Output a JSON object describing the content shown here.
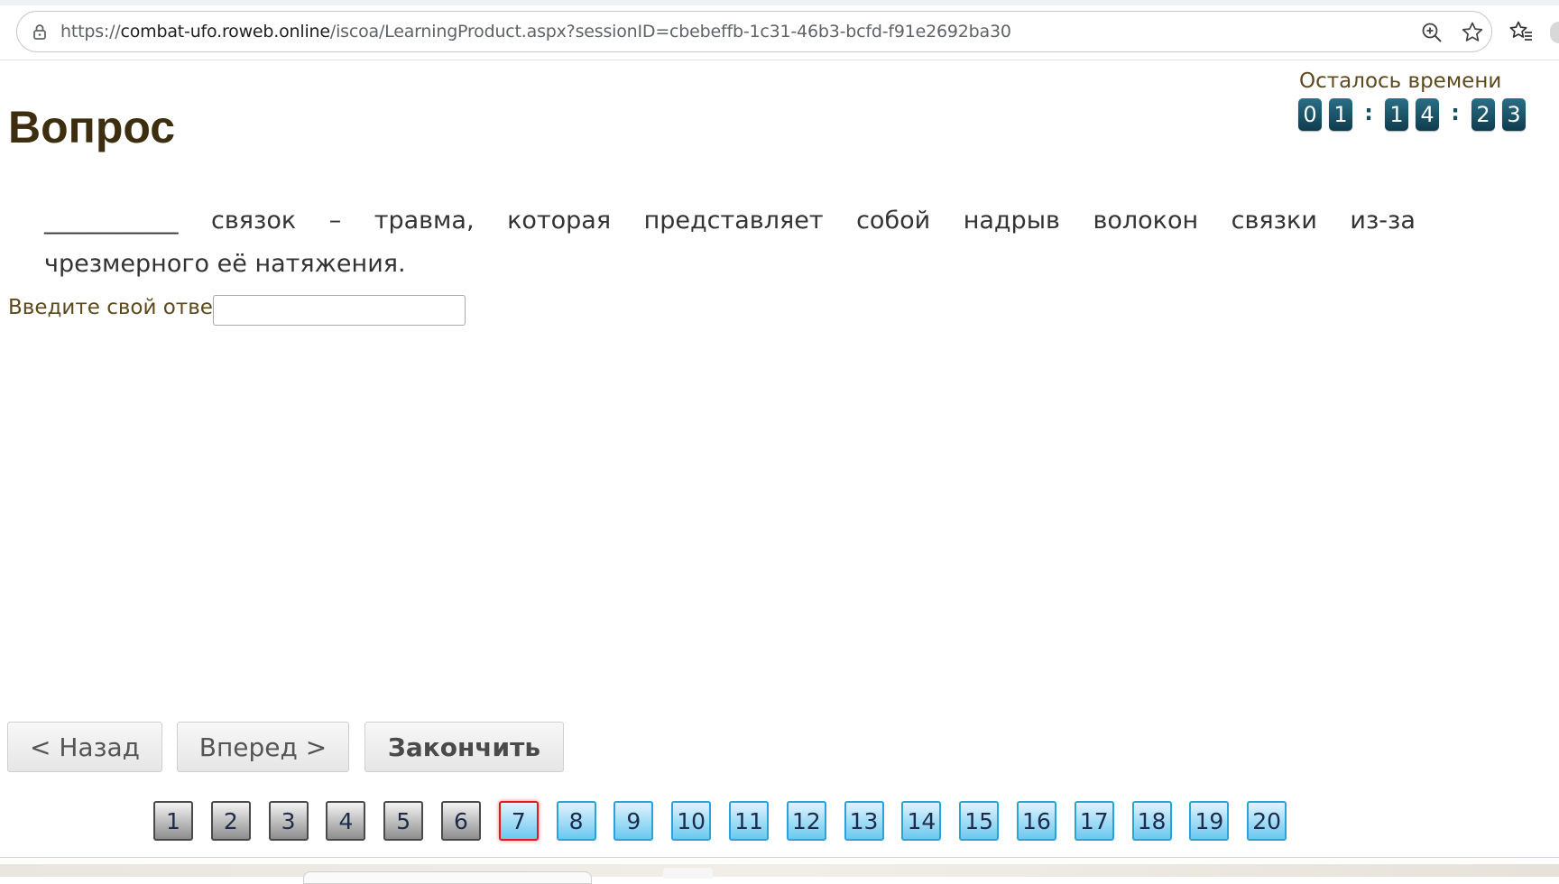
{
  "browser": {
    "url_prefix": "https://",
    "url_host": "combat-ufo.roweb.online",
    "url_path": "/iscoa/LearningProduct.aspx?sessionID=cbebeffb-1c31-46b3-bcfd-f91e2692ba30",
    "icons": [
      "lock-icon",
      "zoom-icon",
      "star-icon",
      "favorites-icon"
    ]
  },
  "page": {
    "title": "Вопрос"
  },
  "timer": {
    "label": "Осталось времени",
    "digits": [
      "0",
      "1",
      "1",
      "4",
      "2",
      "3"
    ],
    "separator": ":"
  },
  "question": {
    "line1_words": [
      "___________",
      "связок",
      "–",
      "травма,",
      "которая",
      "представляет",
      "собой",
      "надрыв",
      "волокон",
      "связки",
      "из-за"
    ],
    "line2": "чрезмерного её натяжения."
  },
  "answer": {
    "label": "Введите свой ответ",
    "value": "",
    "placeholder": ""
  },
  "buttons": {
    "back": "< Назад",
    "next": "Вперед >",
    "finish": "Закончить"
  },
  "pager": {
    "current": 7,
    "items": [
      {
        "label": "1",
        "state": "answered"
      },
      {
        "label": "2",
        "state": "answered"
      },
      {
        "label": "3",
        "state": "answered"
      },
      {
        "label": "4",
        "state": "answered"
      },
      {
        "label": "5",
        "state": "answered"
      },
      {
        "label": "6",
        "state": "answered"
      },
      {
        "label": "7",
        "state": "current"
      },
      {
        "label": "8",
        "state": "todo"
      },
      {
        "label": "9",
        "state": "todo"
      },
      {
        "label": "10",
        "state": "todo"
      },
      {
        "label": "11",
        "state": "todo"
      },
      {
        "label": "12",
        "state": "todo"
      },
      {
        "label": "13",
        "state": "todo"
      },
      {
        "label": "14",
        "state": "todo"
      },
      {
        "label": "15",
        "state": "todo"
      },
      {
        "label": "16",
        "state": "todo"
      },
      {
        "label": "17",
        "state": "todo"
      },
      {
        "label": "18",
        "state": "todo"
      },
      {
        "label": "19",
        "state": "todo"
      },
      {
        "label": "20",
        "state": "todo"
      }
    ]
  },
  "colors": {
    "title": "#3d2e0f",
    "label": "#5c4a1e",
    "timer_digit": "#14485c",
    "pager_current_border": "#e11a1a",
    "pager_todo": "#6cc8ef"
  }
}
